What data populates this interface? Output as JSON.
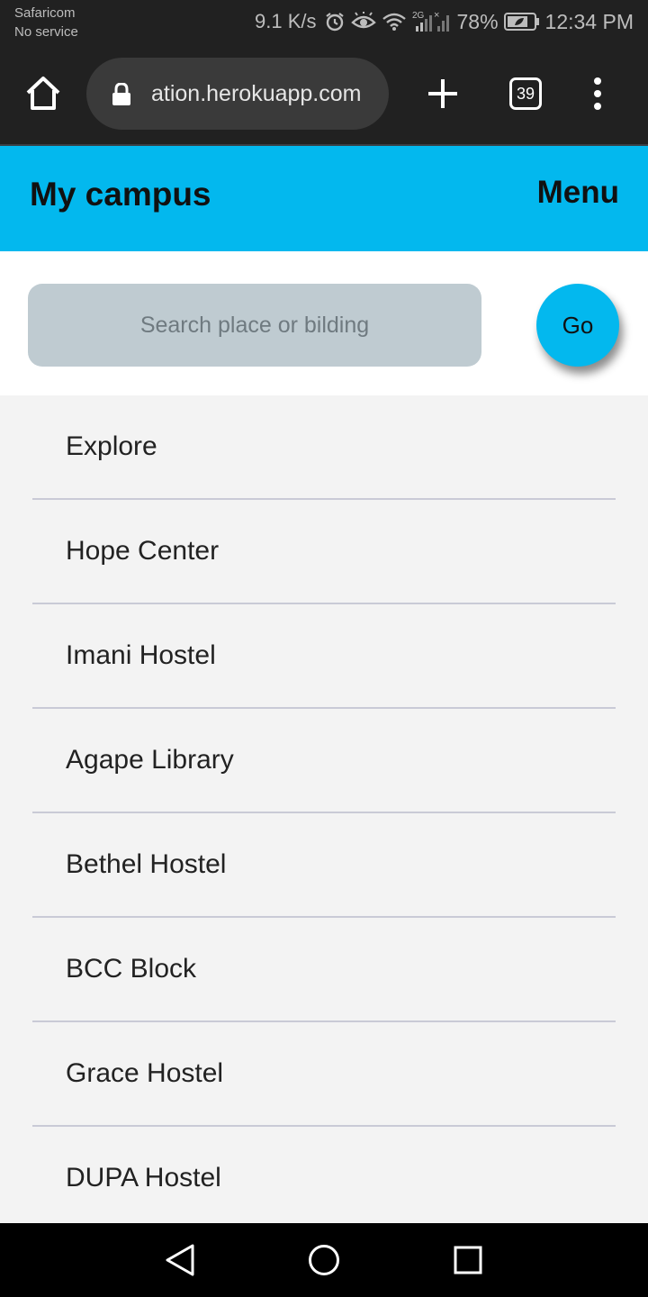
{
  "status_bar": {
    "carrier": "Safaricom",
    "service": "No service",
    "net_speed": "9.1 K/s",
    "signal_type": "2G",
    "battery": "78%",
    "time": "12:34 PM"
  },
  "browser": {
    "url": "ation.herokuapp.com",
    "tab_count": "39"
  },
  "app": {
    "title": "My campus",
    "menu_label": "Menu",
    "accent_color": "#03b8ee"
  },
  "search": {
    "placeholder": "Search place or bilding",
    "value": "",
    "go_label": "Go"
  },
  "places": [
    "Explore",
    "Hope Center",
    "Imani Hostel",
    "Agape Library",
    "Bethel Hostel",
    "BCC Block",
    "Grace Hostel",
    "DUPA Hostel"
  ]
}
